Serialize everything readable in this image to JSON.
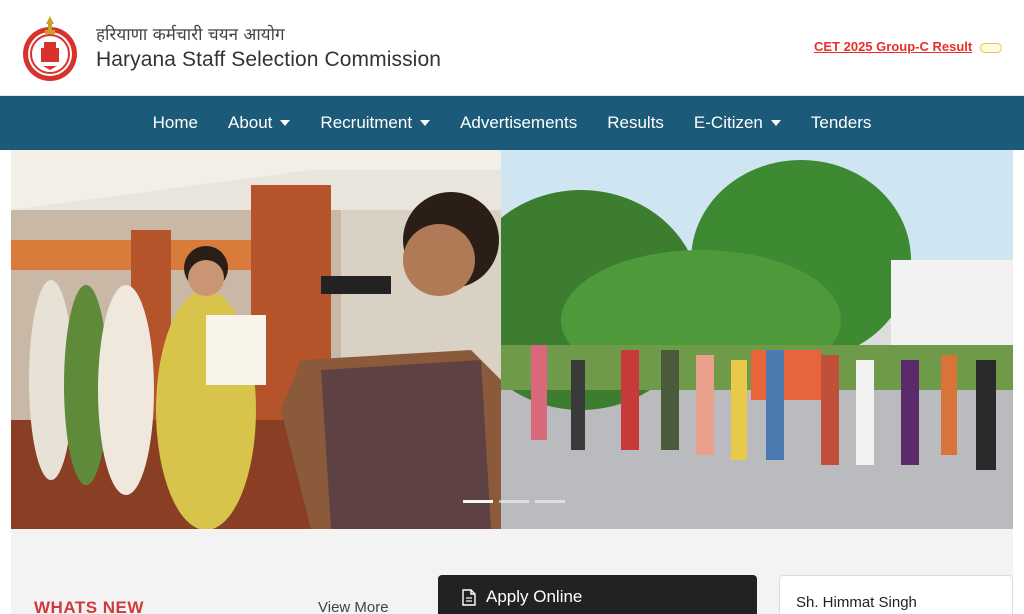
{
  "header": {
    "title_hindi": "हरियाणा कर्मचारी चयन आयोग",
    "title_english": "Haryana Staff Selection Commission",
    "cet_link": "CET 2025 Group-C Result",
    "brand_red": "#e8302a"
  },
  "nav": {
    "background": "#1b5a78",
    "items": [
      {
        "label": "Home",
        "dropdown": false
      },
      {
        "label": "About",
        "dropdown": true
      },
      {
        "label": "Recruitment",
        "dropdown": true
      },
      {
        "label": "Advertisements",
        "dropdown": false
      },
      {
        "label": "Results",
        "dropdown": false
      },
      {
        "label": "E-Citizen",
        "dropdown": true
      },
      {
        "label": "Tenders",
        "dropdown": false
      }
    ]
  },
  "hero": {
    "active_slide": 1,
    "slide_count": 3
  },
  "bottom": {
    "whats_new": "WHATS NEW",
    "view_more": "View More",
    "apply_online": "Apply Online",
    "person_name": "Sh. Himmat Singh"
  }
}
